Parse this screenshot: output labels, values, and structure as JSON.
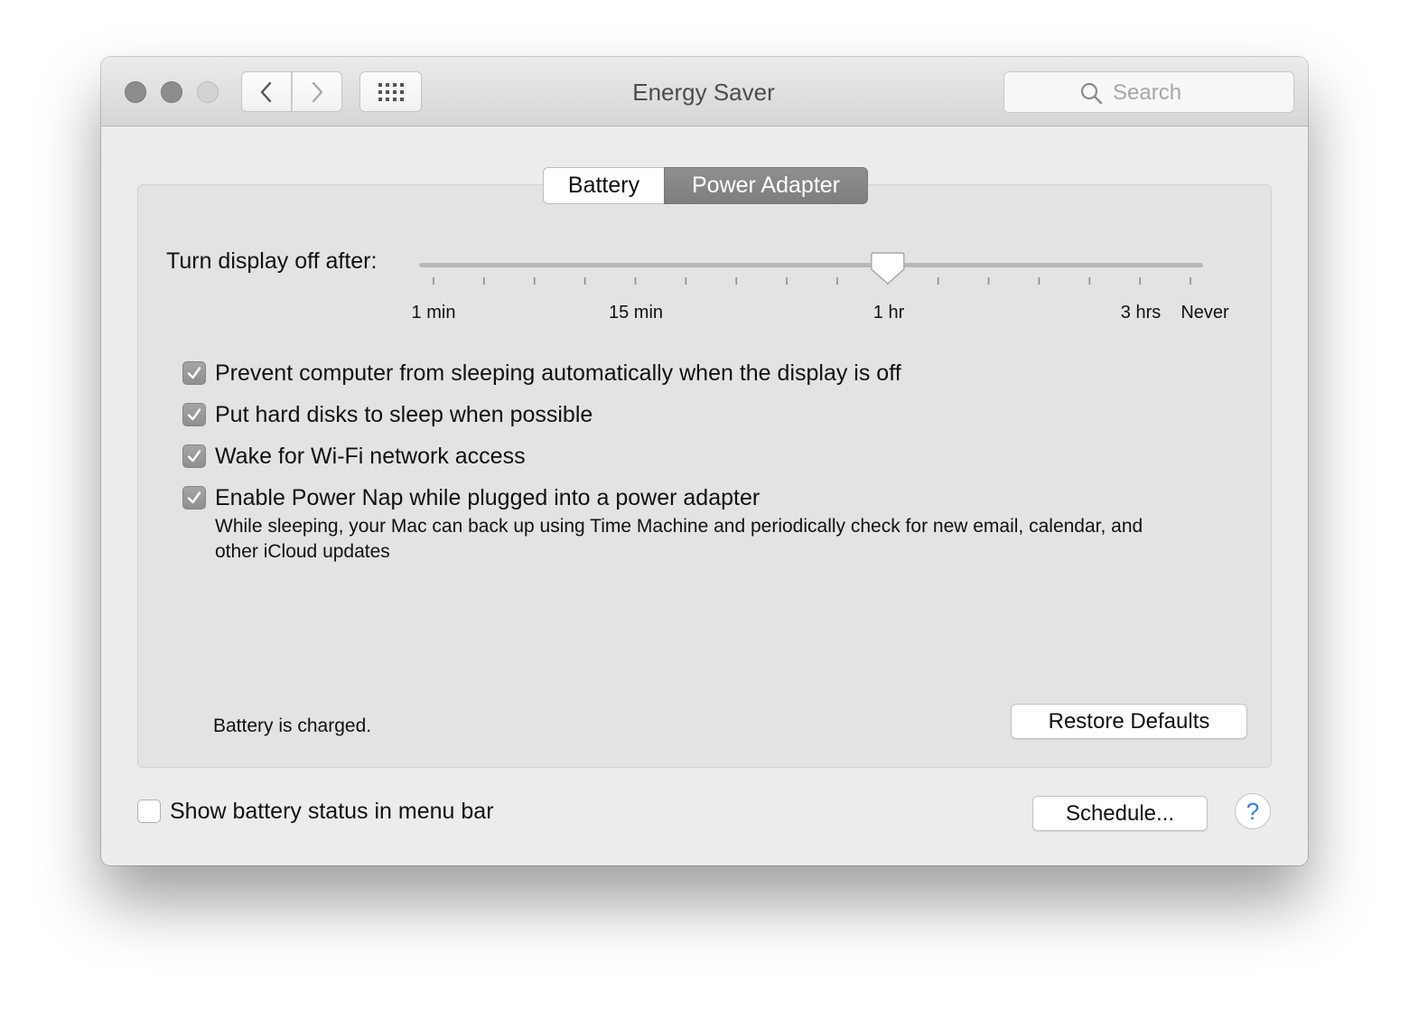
{
  "window": {
    "title": "Energy Saver"
  },
  "toolbar": {
    "back_icon": "chevron-left-icon",
    "forward_icon": "chevron-right-icon",
    "show_all_icon": "grid-icon",
    "search_placeholder": "Search",
    "search_icon": "magnifier-icon"
  },
  "tabs": [
    {
      "label": "Battery",
      "selected": false
    },
    {
      "label": "Power Adapter",
      "selected": true
    }
  ],
  "display_sleep": {
    "label": "Turn display off after:",
    "tick_labels": [
      "1 min",
      "15 min",
      "1 hr",
      "3 hrs",
      "Never"
    ],
    "tick_count": 16,
    "selected_tick_index": 9,
    "selected_value": "1 hr"
  },
  "options": [
    {
      "label": "Prevent computer from sleeping automatically when the display is off",
      "checked": true
    },
    {
      "label": "Put hard disks to sleep when possible",
      "checked": true
    },
    {
      "label": "Wake for Wi-Fi network access",
      "checked": true
    },
    {
      "label": "Enable Power Nap while plugged into a power adapter",
      "checked": true
    }
  ],
  "power_nap_description": "While sleeping, your Mac can back up using Time Machine and periodically check for new email, calendar, and other iCloud updates",
  "battery_status": "Battery is charged.",
  "buttons": {
    "restore_defaults": "Restore Defaults",
    "schedule": "Schedule...",
    "help": "?"
  },
  "menu_bar_option": {
    "label": "Show battery status in menu bar",
    "checked": false
  },
  "colors": {
    "window_bg": "#ececec",
    "panel_bg": "#e3e3e3",
    "selected_tab": "#848484",
    "help_accent": "#3478f6"
  }
}
